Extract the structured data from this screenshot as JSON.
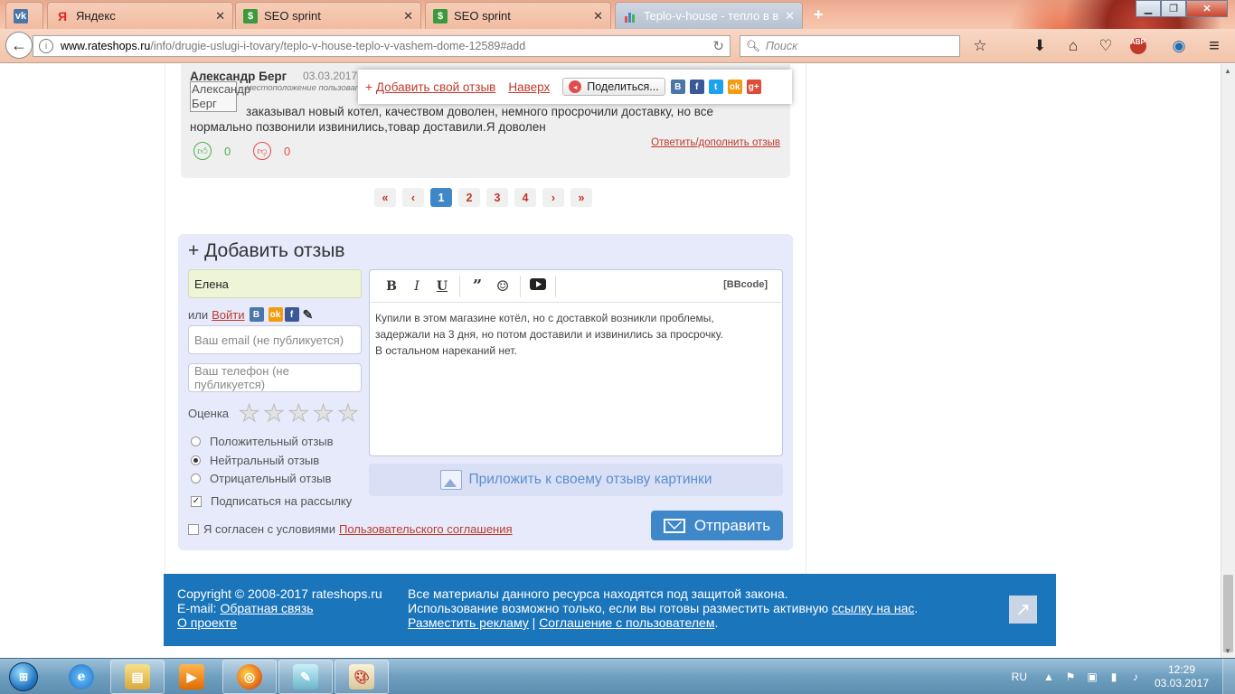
{
  "browser": {
    "tabs": [
      {
        "label": "",
        "icon": "vk-icon",
        "color": "#4a76a8"
      },
      {
        "label": "Яндекс",
        "icon": "yandex-icon",
        "color": "#e52620"
      },
      {
        "label": "SEO sprint",
        "icon": "seosprint-icon",
        "color": "#3b9a3b"
      },
      {
        "label": "SEO sprint",
        "icon": "seosprint-icon",
        "color": "#3b9a3b"
      },
      {
        "label": "Teplo-v-house - тепло в в...",
        "icon": "chart-icon",
        "color": "#3e88c9",
        "active": true
      }
    ],
    "tab_close": "✕",
    "new_tab": "+",
    "url_domain": "www.rateshops.ru",
    "url_path": "/info/drugie-uslugi-i-tovary/teplo-v-house-teplo-v-vashem-dome-12589#add",
    "search_placeholder": "Поиск"
  },
  "review": {
    "author": "Александр Берг",
    "date": "03.03.2017",
    "avatar_alt": "Александр Берг",
    "location": "местоположение пользователя",
    "text_line1": "заказывал новый котел, качеством доволен, немного просрочили доставку, но все",
    "text_line2": "нормально позвонили извинились,товар доставили.Я доволен",
    "reply_label": "Ответить/дополнить отзыв",
    "likes": "0",
    "dislikes": "0"
  },
  "floatbar": {
    "plus": "+",
    "add_review": "Добавить свой отзыв",
    "to_top": "Наверх",
    "share": "Поделиться..."
  },
  "pagination": {
    "first": "«",
    "prev": "‹",
    "pages": [
      "1",
      "2",
      "3",
      "4"
    ],
    "current": "1",
    "next": "›",
    "last": "»"
  },
  "form": {
    "title": "+ Добавить отзыв",
    "name_value": "Елена",
    "or_label": "или",
    "login_label": "Войти",
    "email_placeholder": "Ваш email (не публикуется)",
    "phone_placeholder": "Ваш телефон (не публикуется)",
    "rating_label": "Оценка",
    "rating_value": 0,
    "rating_max": 5,
    "options": [
      "Положительный отзыв",
      "Нейтральный отзыв",
      "Отрицательный отзыв"
    ],
    "selected_option": "Нейтральный отзыв",
    "subscribe_label": "Подписаться на рассылку",
    "subscribe_checked": true,
    "agree_label": "Я согласен с условиями",
    "agree_link": "Пользовательского соглашения",
    "agree_checked": false,
    "editor_bbcode": "[BBcode]",
    "editor_line1": "Купили в этом магазине котёл, но с доставкой возникли проблемы,",
    "editor_line2": "задержали на 3 дня, но потом доставили и извинились за просрочку.",
    "editor_line3": "В остальном нареканий нет.",
    "attach_label": "Приложить к своему отзыву картинки",
    "send_label": "Отправить"
  },
  "footer": {
    "copyright": "Copyright © 2008-2017 rateshops.ru",
    "email_label": "E-mail:",
    "feedback_link": "Обратная связь",
    "about_link": "О проекте",
    "notice1": "Все материалы данного ресурса находятся под защитой закона.",
    "notice2_pre": "Использование возможно только, если вы готовы разместить активную",
    "notice2_link": "ссылку на нас",
    "notice2_post": ".",
    "ads_link": "Разместить рекламу",
    "sep": "|",
    "agreement_link": "Соглашение с пользователем",
    "agreement_post": "."
  },
  "taskbar": {
    "lang": "RU",
    "time": "12:29",
    "date": "03.03.2017"
  },
  "colors": {
    "accent_red": "#c0392b",
    "accent_blue": "#3e88c9",
    "footer_blue": "#1b75bb",
    "form_bg": "#e6eafa"
  }
}
